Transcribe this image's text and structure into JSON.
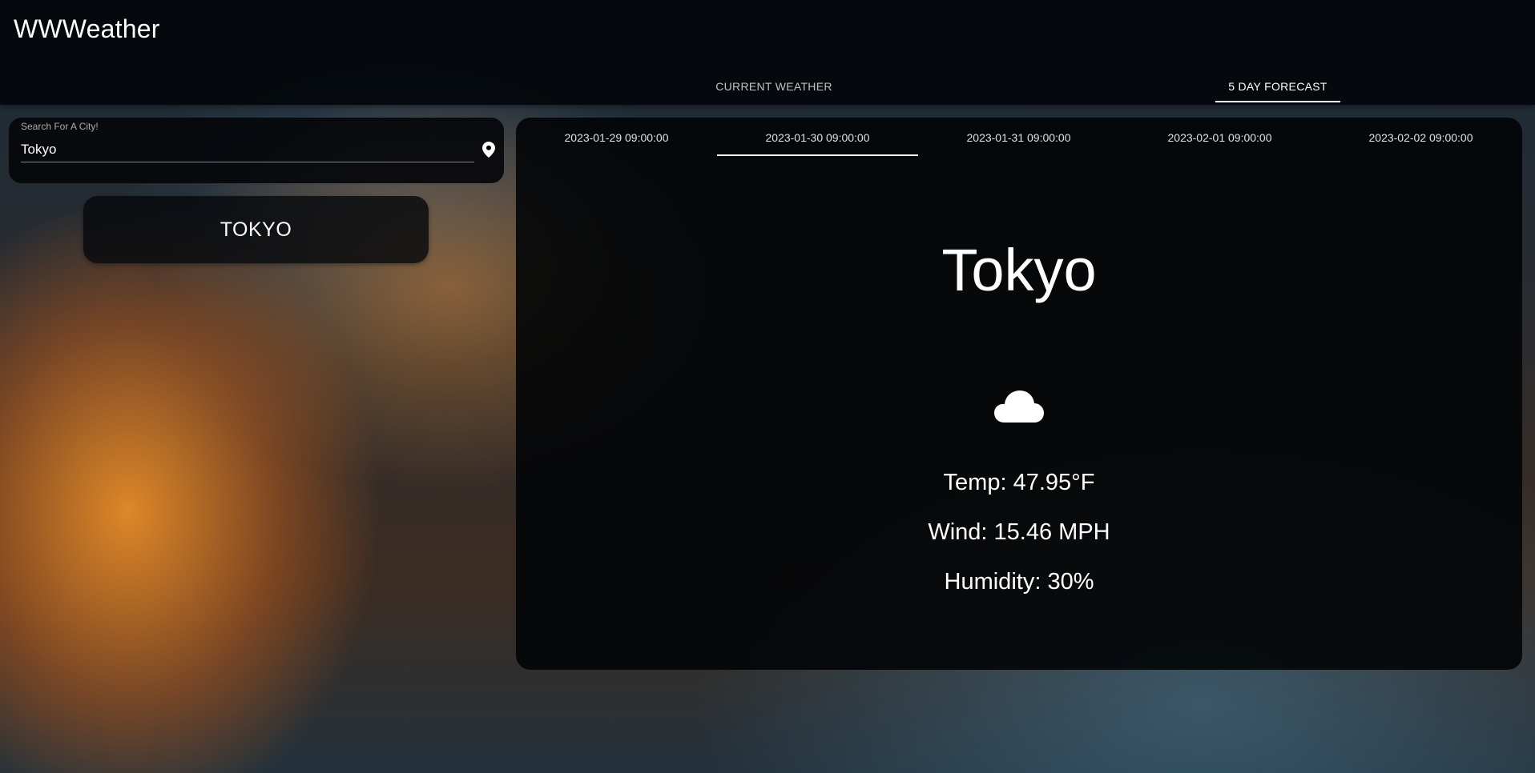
{
  "app": {
    "title": "WWWeather"
  },
  "nav": {
    "tabs": [
      {
        "label": "CURRENT WEATHER",
        "active": false
      },
      {
        "label": "5 DAY FORECAST",
        "active": true
      }
    ]
  },
  "search": {
    "label": "Search For A City!",
    "value": "Tokyo",
    "location_icon": "map-pin-icon"
  },
  "city_button": {
    "label": "TOKYO"
  },
  "forecast": {
    "days": [
      {
        "label": "2023-01-29 09:00:00",
        "active": false
      },
      {
        "label": "2023-01-30 09:00:00",
        "active": true
      },
      {
        "label": "2023-01-31 09:00:00",
        "active": false
      },
      {
        "label": "2023-02-01 09:00:00",
        "active": false
      },
      {
        "label": "2023-02-02 09:00:00",
        "active": false
      }
    ],
    "city": "Tokyo",
    "icon": "cloud-icon",
    "temp_label": "Temp: ",
    "temp_value": "47.95°F",
    "wind_label": "Wind: ",
    "wind_value": "15.46 MPH",
    "humidity_label": "Humidity: ",
    "humidity_value": "30%"
  },
  "colors": {
    "panel": "#020407",
    "text": "#ffffff",
    "indicator": "#ffffff"
  }
}
